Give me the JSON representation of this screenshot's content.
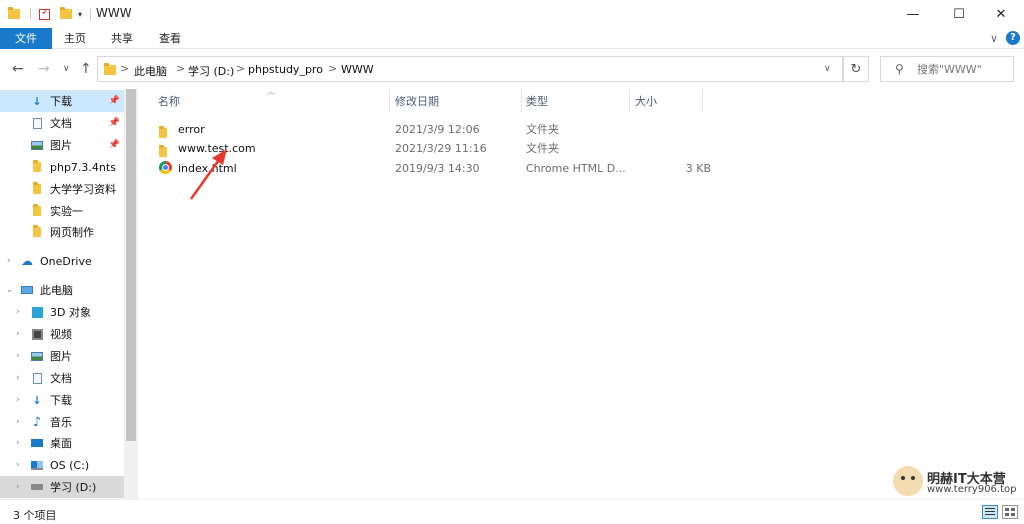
{
  "window": {
    "title": "WWW",
    "minimize": "—",
    "maximize": "☐",
    "close": "✕"
  },
  "ribbon": {
    "tabs": [
      "文件",
      "主页",
      "共享",
      "查看"
    ],
    "collapse": "∨",
    "help": "?"
  },
  "address": {
    "back": "←",
    "forward": "→",
    "recent": "∨",
    "up": "↑",
    "crumbs": [
      "此电脑",
      "学习 (D:)",
      "phpstudy_pro",
      "WWW"
    ],
    "sep": ">",
    "dropdown": "∨",
    "refresh": "↻",
    "search_placeholder": "搜索\"WWW\""
  },
  "nav": {
    "quick_access": [
      {
        "label": "下载",
        "icon": "download-icon",
        "pinned": true
      },
      {
        "label": "文档",
        "icon": "document-icon",
        "pinned": true
      },
      {
        "label": "图片",
        "icon": "picture-icon",
        "pinned": true
      },
      {
        "label": "php7.3.4nts",
        "icon": "folder-icon",
        "pinned": false
      },
      {
        "label": "大学学习资料",
        "icon": "folder-icon",
        "pinned": false
      },
      {
        "label": "实验一",
        "icon": "folder-icon",
        "pinned": false
      },
      {
        "label": "网页制作",
        "icon": "folder-icon",
        "pinned": false
      }
    ],
    "onedrive": "OneDrive",
    "this_pc": "此电脑",
    "this_pc_items": [
      {
        "label": "3D 对象",
        "icon": "3d-objects-icon"
      },
      {
        "label": "视频",
        "icon": "video-icon"
      },
      {
        "label": "图片",
        "icon": "picture-icon"
      },
      {
        "label": "文档",
        "icon": "document-icon"
      },
      {
        "label": "下载",
        "icon": "download-icon"
      },
      {
        "label": "音乐",
        "icon": "music-icon"
      },
      {
        "label": "桌面",
        "icon": "desktop-icon"
      },
      {
        "label": "OS (C:)",
        "icon": "windows-drive-icon"
      },
      {
        "label": "学习 (D:)",
        "icon": "drive-icon"
      }
    ]
  },
  "columns": {
    "name": "名称",
    "date": "修改日期",
    "type": "类型",
    "size": "大小"
  },
  "files": [
    {
      "name": "error",
      "date": "2021/3/9 12:06",
      "type": "文件夹",
      "size": "",
      "icon": "folder-icon"
    },
    {
      "name": "www.test.com",
      "date": "2021/3/29 11:16",
      "type": "文件夹",
      "size": "",
      "icon": "folder-icon"
    },
    {
      "name": "index.html",
      "date": "2019/9/3 14:30",
      "type": "Chrome HTML D...",
      "size": "3 KB",
      "icon": "chrome-icon"
    }
  ],
  "status": {
    "count": "3 个项目"
  },
  "watermark": {
    "title": "明赫IT大本营",
    "url": "www.terry906.top"
  },
  "colors": {
    "accent": "#1979ca",
    "selection": "#cce8ff",
    "annotation_arrow": "#e8382b"
  }
}
